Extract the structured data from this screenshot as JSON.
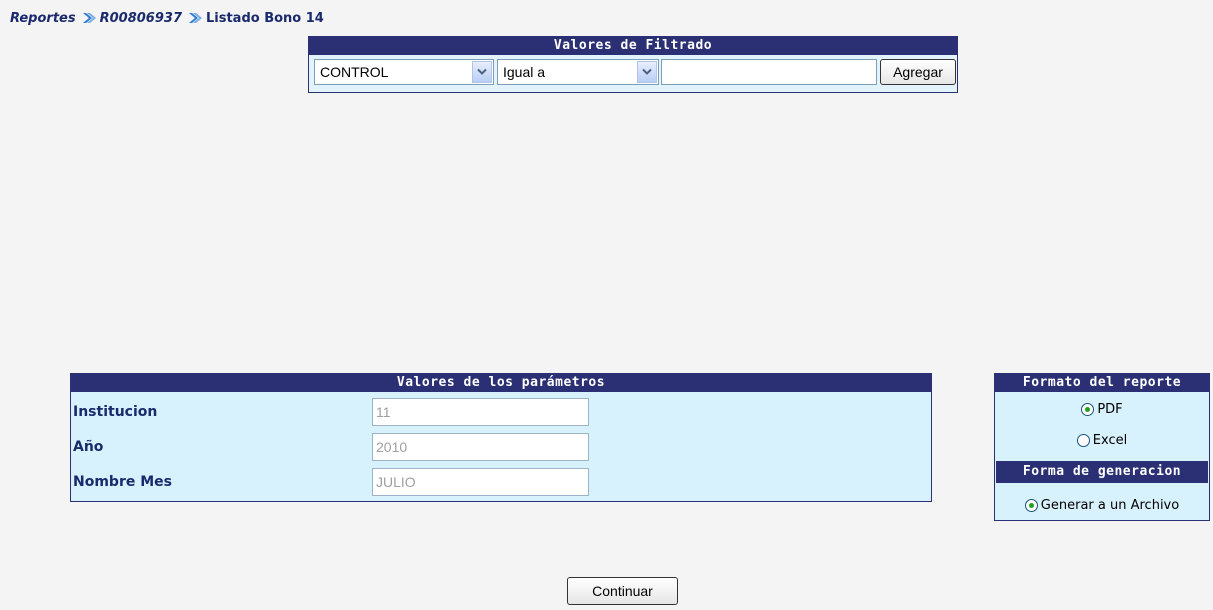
{
  "breadcrumb": {
    "items": [
      "Reportes",
      "R00806937",
      "Listado Bono 14"
    ]
  },
  "filter": {
    "title": "Valores de Filtrado",
    "field_select": "CONTROL",
    "operator_select": "Igual a",
    "value": "",
    "add_label": "Agregar"
  },
  "params": {
    "title": "Valores de los parámetros",
    "rows": [
      {
        "label": "Institucion",
        "value": "11"
      },
      {
        "label": "Año",
        "value": "2010"
      },
      {
        "label": "Nombre Mes",
        "value": "JULIO"
      }
    ]
  },
  "format": {
    "title": "Formato del reporte",
    "options": [
      {
        "label": "PDF",
        "checked": true
      },
      {
        "label": "Excel",
        "checked": false
      }
    ],
    "generation_title": "Forma de generacion",
    "generation_option": {
      "label": "Generar a un Archivo",
      "checked": true
    }
  },
  "continue_label": "Continuar",
  "colors": {
    "header_bg": "#2a3073",
    "panel_bg": "#d7f1fd",
    "breadcrumb": "#1a2a6c"
  }
}
